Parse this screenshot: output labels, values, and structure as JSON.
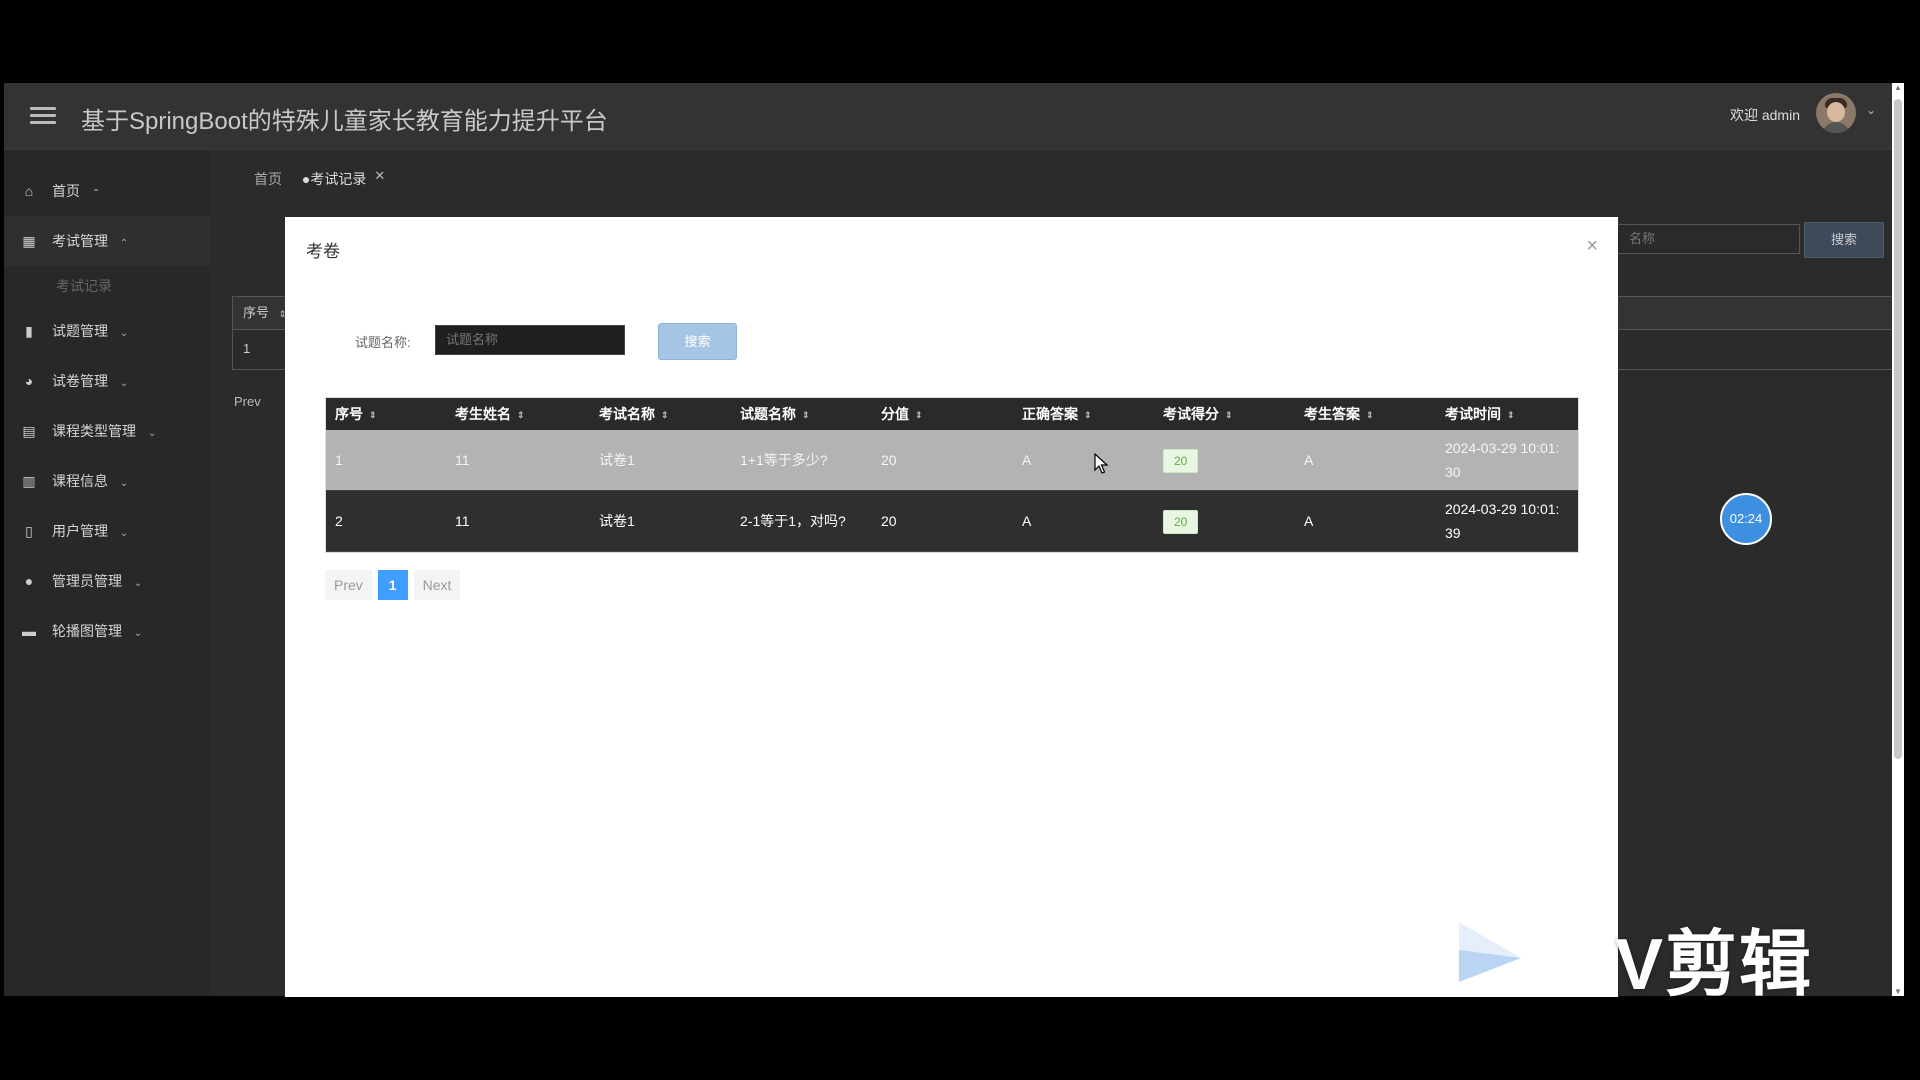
{
  "header": {
    "app_title": "基于SpringBoot的特殊儿童家长教育能力提升平台",
    "welcome_text": "欢迎 admin"
  },
  "sidebar": {
    "items": [
      {
        "label": "首页",
        "icon": "home-icon",
        "chevron": "⌃"
      },
      {
        "label": "考试管理",
        "icon": "exam-icon",
        "chevron": "⌃"
      },
      {
        "label": "试题管理",
        "icon": "question-icon",
        "chevron": "⌄"
      },
      {
        "label": "试卷管理",
        "icon": "paper-icon",
        "chevron": "⌄"
      },
      {
        "label": "课程类型管理",
        "icon": "course-type-icon",
        "chevron": "⌄"
      },
      {
        "label": "课程信息",
        "icon": "course-info-icon",
        "chevron": "⌄"
      },
      {
        "label": "用户管理",
        "icon": "user-icon",
        "chevron": "⌄"
      },
      {
        "label": "管理员管理",
        "icon": "admin-icon",
        "chevron": "⌄"
      },
      {
        "label": "轮播图管理",
        "icon": "carousel-icon",
        "chevron": "⌄"
      }
    ],
    "sub_item": "考试记录"
  },
  "tabs": [
    {
      "label": "首页"
    },
    {
      "label": "●考试记录"
    }
  ],
  "background_page": {
    "search_placeholder": "名称",
    "search_button": "搜索",
    "table_header_first": "序号",
    "table_row_first": "1",
    "prev_label": "Prev"
  },
  "modal": {
    "title": "考卷",
    "filter_label": "试题名称:",
    "filter_placeholder": "试题名称",
    "search_button": "搜索",
    "columns": [
      "序号",
      "考生姓名",
      "考试名称",
      "试题名称",
      "分值",
      "正确答案",
      "考试得分",
      "考生答案",
      "考试时间"
    ],
    "rows": [
      {
        "no": "1",
        "name": "11",
        "exam": "试卷1",
        "question": "1+1等于多少?",
        "score_value": "20",
        "correct": "A",
        "score": "20",
        "answer": "A",
        "time_line1": "2024-03-29 10:01:",
        "time_line2": "30"
      },
      {
        "no": "2",
        "name": "11",
        "exam": "试卷1",
        "question": "2-1等于1，对吗?",
        "score_value": "20",
        "correct": "A",
        "score": "20",
        "answer": "A",
        "time_line1": "2024-03-29 10:01:",
        "time_line2": "39"
      }
    ],
    "pagination": {
      "prev": "Prev",
      "current": "1",
      "next": "Next"
    }
  },
  "timer": "02:24",
  "watermark": "V剪辑",
  "colors": {
    "accent": "#409eff",
    "badge_bg": "#eaf6e4",
    "badge_text": "#5fae3c",
    "timer": "#3d8fe0"
  }
}
